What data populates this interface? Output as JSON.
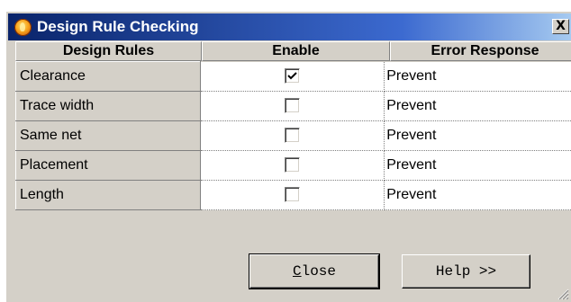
{
  "window": {
    "title": "Design Rule Checking",
    "close_glyph": "X"
  },
  "table": {
    "columns": [
      "Design Rules",
      "Enable",
      "Error Response"
    ],
    "rows": [
      {
        "rule": "Clearance",
        "enabled": true,
        "response": "Prevent"
      },
      {
        "rule": "Trace width",
        "enabled": false,
        "response": "Prevent"
      },
      {
        "rule": "Same net",
        "enabled": false,
        "response": "Prevent"
      },
      {
        "rule": "Placement",
        "enabled": false,
        "response": "Prevent"
      },
      {
        "rule": "Length",
        "enabled": false,
        "response": "Prevent"
      }
    ]
  },
  "buttons": {
    "close_mnemonic": "C",
    "close_rest": "lose",
    "help": "Help >>"
  },
  "icons": {
    "app": "flame-icon",
    "close": "close-icon",
    "checkmark": "checkmark-icon",
    "resize": "resize-grip-icon"
  }
}
